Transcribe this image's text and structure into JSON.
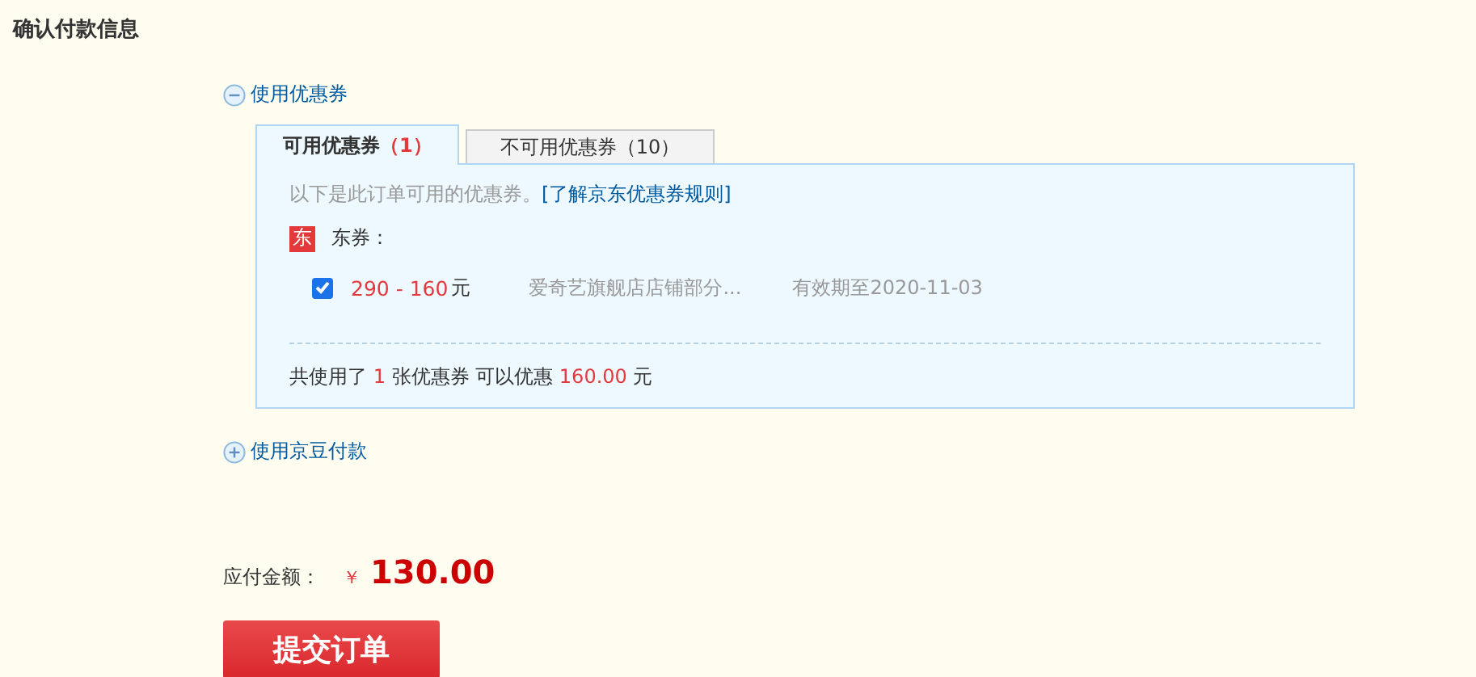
{
  "title": "确认付款信息",
  "coupon_toggle": {
    "label": "使用优惠券",
    "expanded": true
  },
  "tabs": [
    {
      "label": "可用优惠券",
      "count": "（1）",
      "selected": true
    },
    {
      "label": "不可用优惠券",
      "count": "（10）",
      "selected": false
    }
  ],
  "panel": {
    "intro": "以下是此订单可用的优惠券。",
    "rules_link": "[了解京东优惠券规则]",
    "group": {
      "badge": "东",
      "label": "东券："
    },
    "coupons": [
      {
        "checked": true,
        "amount": "290 - 160",
        "unit": "元",
        "shop": "爱奇艺旗舰店店铺部分...",
        "expiry": "有效期至2020-11-03"
      }
    ],
    "summary": [
      {
        "text": "共使用了 ",
        "highlight": false
      },
      {
        "text": "1",
        "highlight": true
      },
      {
        "text": " 张优惠券 可以优惠 ",
        "highlight": false
      },
      {
        "text": "160.00",
        "highlight": true
      },
      {
        "text": " 元",
        "highlight": false
      }
    ]
  },
  "beans_toggle": {
    "label": "使用京豆付款",
    "expanded": false
  },
  "payable": {
    "label": "应付金额：",
    "currency": "￥",
    "amount": "130.00"
  },
  "submit_button": "提交订单"
}
